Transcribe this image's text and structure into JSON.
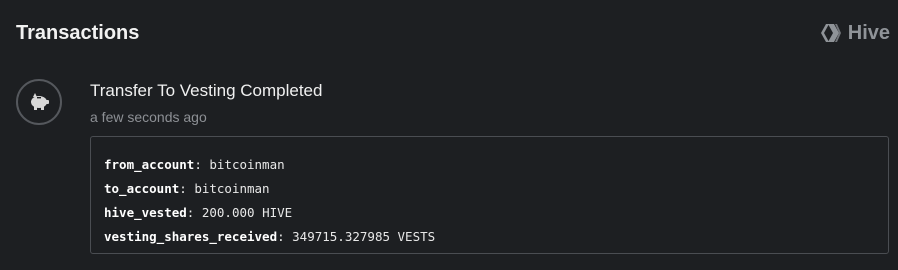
{
  "header": {
    "title": "Transactions",
    "brand_label": "Hive"
  },
  "transaction": {
    "icon": "piggy-bank-icon",
    "title": "Transfer To Vesting Completed",
    "time": "a few seconds ago",
    "fields": [
      {
        "key": "from_account",
        "sep": ": ",
        "value": "bitcoinman"
      },
      {
        "key": "to_account",
        "sep": ": ",
        "value": "bitcoinman"
      },
      {
        "key": "hive_vested",
        "sep": ": ",
        "value": "200.000 HIVE"
      },
      {
        "key": "vesting_shares_received",
        "sep": ": ",
        "value": "349715.327985 VESTS"
      }
    ]
  },
  "colors": {
    "background": "#1d1f22",
    "muted": "#8d9095",
    "border": "#4a4d52"
  }
}
